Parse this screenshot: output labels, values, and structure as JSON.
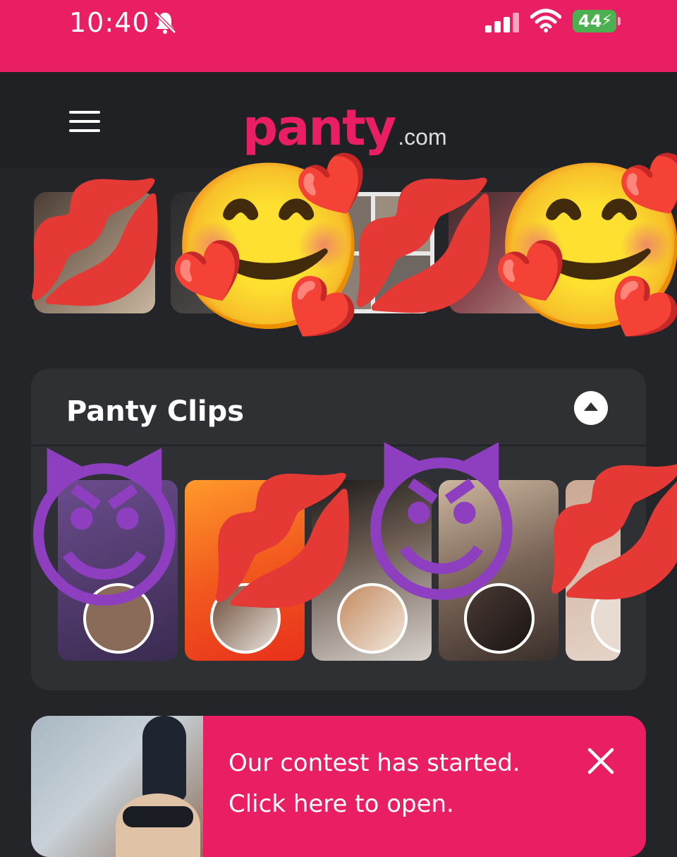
{
  "status_bar": {
    "time": "10:40",
    "battery_level": "44",
    "colors": {
      "bar": "#e91e63",
      "battery": "#4caf50"
    }
  },
  "header": {
    "logo_main": "panty",
    "logo_domain": ".com",
    "menu_icon": "hamburger-icon"
  },
  "story_row": {
    "item_count": 5,
    "overlay_emojis": [
      "kiss-mark",
      "smiling-face-with-hearts",
      "kiss-mark",
      "smiling-face-with-hearts"
    ]
  },
  "clips_section": {
    "title": "Panty Clips",
    "collapse_icon": "chevron-up-icon",
    "clip_count": 5,
    "overlay_emojis": [
      "smiling-imp",
      "kiss-mark",
      "smiling-imp",
      "kiss-mark"
    ]
  },
  "banner": {
    "line1": "Our contest has started.",
    "line2": "Click here to open.",
    "close_icon": "close-icon"
  },
  "theme": {
    "accent": "#e91e63",
    "background": "#242528",
    "card": "#2e3034"
  }
}
